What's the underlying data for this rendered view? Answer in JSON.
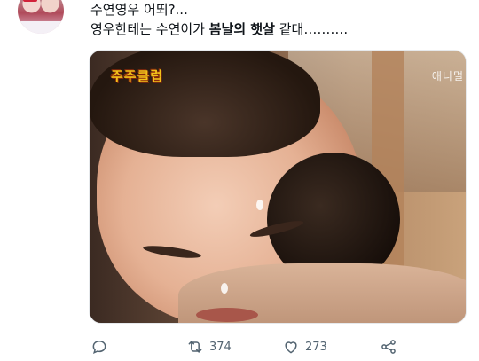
{
  "tweet": {
    "line1": "수연영우 어뙤?...",
    "line2_prefix": "영우한테는 수연이가 ",
    "line2_bold": "봄날의 햇살",
    "line2_suffix": " 같대……….",
    "media": {
      "watermark_left": "주주클럽",
      "watermark_right": "애니멀"
    },
    "actions": {
      "reply_icon": "reply-icon",
      "retweet_icon": "retweet-icon",
      "retweet_count": "374",
      "like_icon": "heart-icon",
      "like_count": "273",
      "share_icon": "share-icon"
    }
  }
}
